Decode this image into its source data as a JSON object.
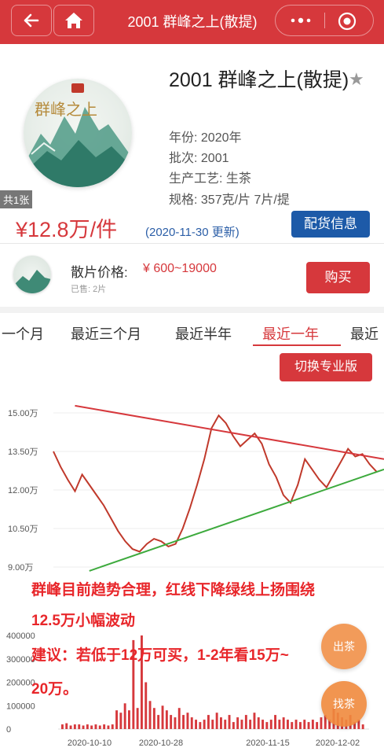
{
  "nav": {
    "title": "2001 群峰之上(散提)",
    "back_icon": "arrow-left-icon",
    "home_icon": "home-icon",
    "more_icon": "ellipsis-icon",
    "target_icon": "target-icon",
    "bar_color": "#d6383c"
  },
  "product": {
    "title": "2001 群峰之上(散提)",
    "image_text": "群峰之上",
    "count_badge": "共1张",
    "year": "年份: 2020年",
    "batch": "批次: 2001",
    "process": "生产工艺: 生茶",
    "spec": "规格: 357克/片 7片/提",
    "price": "¥12.8万/件",
    "price_date": "(2020-11-30 更新)",
    "distribution_button": "配货信息"
  },
  "loose": {
    "label": "散片价格:",
    "range": "¥ 600~19000",
    "sold": "已售: 2片",
    "buy_button": "购买"
  },
  "tabs": [
    "一个月",
    "最近三个月",
    "最近半年",
    "最近一年",
    "最近"
  ],
  "active_tab": 3,
  "switch_button": "切换专业版",
  "annotation": {
    "line1": "群峰目前趋势合理，红线下降绿线上扬围绕",
    "line2": "12.5万小幅波动",
    "line3": "建议：若低于12万可买，1-2年看15万~",
    "line4": "20万。"
  },
  "float_buttons": {
    "sell": "出茶",
    "find": "找茶"
  },
  "colors": {
    "accent": "#d6383c",
    "blue": "#1d5aa8",
    "trend_down": "#d6383c",
    "trend_up": "#3daa3d",
    "price_line": "#c0392b",
    "volume": "#d6383c"
  },
  "chart_data": [
    {
      "type": "line",
      "ylabel": "",
      "yticks": [
        "15.00万",
        "13.50万",
        "12.00万",
        "10.50万",
        "9.00万"
      ],
      "ylim": [
        8.8,
        15.8
      ],
      "x_range": [
        "2020-09-06",
        "2020-12-07"
      ],
      "series": [
        {
          "values": [
            [
              "2020-09-06",
              13.5
            ],
            [
              "2020-09-08",
              12.9
            ],
            [
              "2020-09-10",
              12.4
            ],
            [
              "2020-09-12",
              11.95
            ],
            [
              "2020-09-14",
              12.6
            ],
            [
              "2020-09-16",
              12.2
            ],
            [
              "2020-09-18",
              11.8
            ],
            [
              "2020-09-20",
              11.4
            ],
            [
              "2020-09-22",
              10.9
            ],
            [
              "2020-09-24",
              10.4
            ],
            [
              "2020-09-26",
              10.0
            ],
            [
              "2020-09-28",
              9.7
            ],
            [
              "2020-09-30",
              9.6
            ],
            [
              "2020-10-02",
              9.9
            ],
            [
              "2020-10-04",
              10.1
            ],
            [
              "2020-10-06",
              10.0
            ],
            [
              "2020-10-08",
              9.8
            ],
            [
              "2020-10-10",
              9.9
            ],
            [
              "2020-10-12",
              10.5
            ],
            [
              "2020-10-14",
              11.3
            ],
            [
              "2020-10-16",
              12.2
            ],
            [
              "2020-10-18",
              13.2
            ],
            [
              "2020-10-20",
              14.4
            ],
            [
              "2020-10-22",
              14.9
            ],
            [
              "2020-10-24",
              14.6
            ],
            [
              "2020-10-26",
              14.1
            ],
            [
              "2020-10-28",
              13.7
            ],
            [
              "2020-10-30",
              13.95
            ],
            [
              "2020-11-01",
              14.2
            ],
            [
              "2020-11-03",
              13.8
            ],
            [
              "2020-11-05",
              13.0
            ],
            [
              "2020-11-07",
              12.5
            ],
            [
              "2020-11-09",
              11.8
            ],
            [
              "2020-11-11",
              11.5
            ],
            [
              "2020-11-13",
              12.2
            ],
            [
              "2020-11-15",
              13.2
            ],
            [
              "2020-11-17",
              12.8
            ],
            [
              "2020-11-19",
              12.4
            ],
            [
              "2020-11-21",
              12.1
            ],
            [
              "2020-11-23",
              12.6
            ],
            [
              "2020-11-25",
              13.1
            ],
            [
              "2020-11-27",
              13.6
            ],
            [
              "2020-11-29",
              13.3
            ],
            [
              "2020-12-01",
              13.4
            ],
            [
              "2020-12-03",
              13.0
            ],
            [
              "2020-12-05",
              12.7
            ]
          ]
        }
      ],
      "trendlines": [
        {
          "from": [
            "2020-09-12",
            15.28
          ],
          "to": [
            "2020-12-07",
            13.2
          ]
        },
        {
          "from": [
            "2020-09-16",
            8.85
          ],
          "to": [
            "2020-12-07",
            12.8
          ]
        }
      ]
    },
    {
      "type": "bar",
      "xlabels": [
        "2020-10-10",
        "2020-10-28",
        "2020-11-15",
        "2020-12-02"
      ],
      "yticks": [
        "400000",
        "300000",
        "200000",
        "100000",
        "0"
      ],
      "ylim": [
        0,
        400000
      ],
      "values": [
        20000,
        25000,
        15000,
        20000,
        20000,
        15000,
        20000,
        15000,
        20000,
        15000,
        20000,
        15000,
        20000,
        80000,
        70000,
        110000,
        80000,
        380000,
        90000,
        420000,
        200000,
        120000,
        90000,
        60000,
        100000,
        80000,
        60000,
        50000,
        90000,
        60000,
        70000,
        50000,
        40000,
        30000,
        40000,
        60000,
        40000,
        70000,
        50000,
        40000,
        60000,
        30000,
        50000,
        40000,
        60000,
        40000,
        70000,
        50000,
        40000,
        30000,
        40000,
        60000,
        40000,
        50000,
        40000,
        30000,
        40000,
        30000,
        40000,
        30000,
        40000,
        30000,
        50000,
        60000,
        40000,
        90000,
        70000,
        50000,
        40000,
        60000,
        30000,
        40000,
        20000
      ]
    }
  ]
}
